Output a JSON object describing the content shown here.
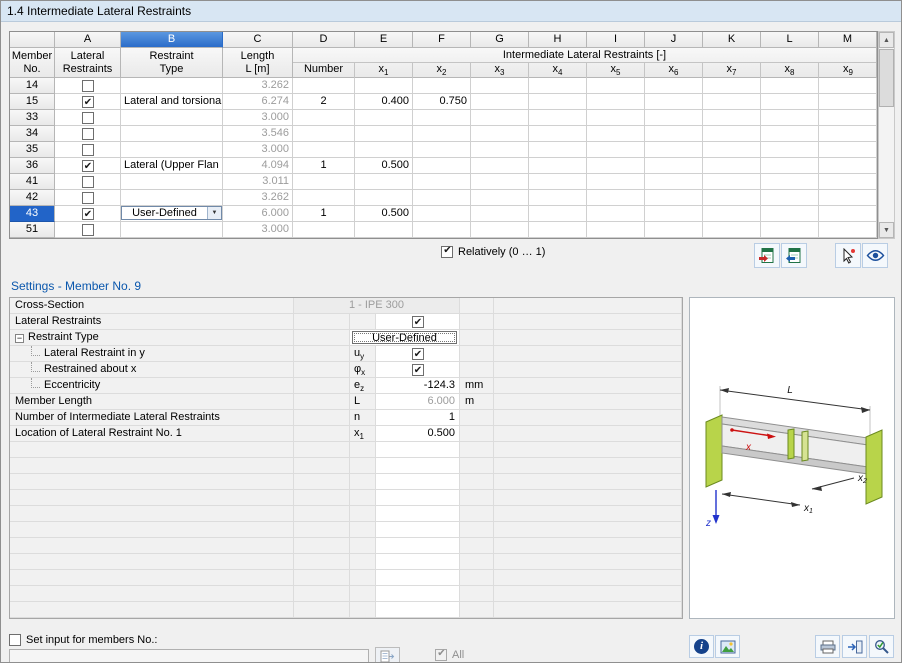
{
  "title": "1.4 Intermediate Lateral Restraints",
  "table": {
    "letters": [
      "A",
      "B",
      "C",
      "D",
      "E",
      "F",
      "G",
      "H",
      "I",
      "J",
      "K",
      "L",
      "M"
    ],
    "selected_letter": "B",
    "header": {
      "member1": "Member",
      "member2": "No.",
      "col_a1": "Lateral",
      "col_a2": "Restraints",
      "col_b1": "Restraint",
      "col_b2": "Type",
      "col_c1": "Length",
      "col_c2": "L [m]",
      "group": "Intermediate Lateral Restraints [-]",
      "number": "Number",
      "x_base": "x",
      "x_subs": [
        "1",
        "2",
        "3",
        "4",
        "5",
        "6",
        "7",
        "8",
        "9"
      ]
    },
    "rows": [
      {
        "no": "14",
        "checked": false,
        "type": "",
        "length": "3.262",
        "number": "",
        "x1": "",
        "x2": ""
      },
      {
        "no": "15",
        "checked": true,
        "type": "Lateral and torsiona",
        "length": "6.274",
        "number": "2",
        "x1": "0.400",
        "x2": "0.750"
      },
      {
        "no": "33",
        "checked": false,
        "type": "",
        "length": "3.000",
        "number": "",
        "x1": "",
        "x2": ""
      },
      {
        "no": "34",
        "checked": false,
        "type": "",
        "length": "3.546",
        "number": "",
        "x1": "",
        "x2": ""
      },
      {
        "no": "35",
        "checked": false,
        "type": "",
        "length": "3.000",
        "number": "",
        "x1": "",
        "x2": ""
      },
      {
        "no": "36",
        "checked": true,
        "type": "Lateral (Upper Flan",
        "length": "4.094",
        "number": "1",
        "x1": "0.500",
        "x2": ""
      },
      {
        "no": "41",
        "checked": false,
        "type": "",
        "length": "3.011",
        "number": "",
        "x1": "",
        "x2": ""
      },
      {
        "no": "42",
        "checked": false,
        "type": "",
        "length": "3.262",
        "number": "",
        "x1": "",
        "x2": ""
      },
      {
        "no": "43",
        "checked": true,
        "type": "User-Defined",
        "length": "6.000",
        "number": "1",
        "x1": "0.500",
        "x2": ""
      },
      {
        "no": "51",
        "checked": false,
        "type": "",
        "length": "3.000",
        "number": "",
        "x1": "",
        "x2": ""
      }
    ],
    "relatively_label": "Relatively (0 … 1)",
    "relatively_checked": true
  },
  "settings": {
    "heading": "Settings - Member No. 9",
    "cross_section": {
      "label": "Cross-Section",
      "value": "1 - IPE 300"
    },
    "lateral": {
      "label": "Lateral Restraints"
    },
    "lateral_checked": true,
    "restraint_type": {
      "label": "Restraint Type",
      "value": "User-Defined"
    },
    "uy": {
      "label": "Lateral Restraint in y",
      "sym": "u",
      "sub": "y"
    },
    "uy_checked": true,
    "phix": {
      "label": "Restrained about x",
      "sym": "φ",
      "sub": "x"
    },
    "phix_checked": true,
    "ecc": {
      "label": "Eccentricity",
      "sym": "e",
      "sub": "z",
      "value": "-124.3",
      "unit": "mm"
    },
    "len": {
      "label": "Member Length",
      "sym": "L",
      "sub": "",
      "value": "6.000",
      "unit": "m"
    },
    "n": {
      "label": "Number of Intermediate Lateral Restraints",
      "sym": "n",
      "sub": "",
      "value": "1"
    },
    "x1": {
      "label": "Location of Lateral Restraint No. 1",
      "sym": "x",
      "sub": "1",
      "value": "0.500"
    }
  },
  "footer": {
    "set_input": "Set input for members No.:",
    "set_input_checked": false,
    "members": "",
    "all": "All",
    "all_checked": true
  },
  "illustration": {
    "dim_length": "L",
    "axis_x": "x",
    "x1_base": "x",
    "x1_sub": "1",
    "x2_base": "x",
    "x2_sub": "2",
    "axis_z": "z"
  }
}
